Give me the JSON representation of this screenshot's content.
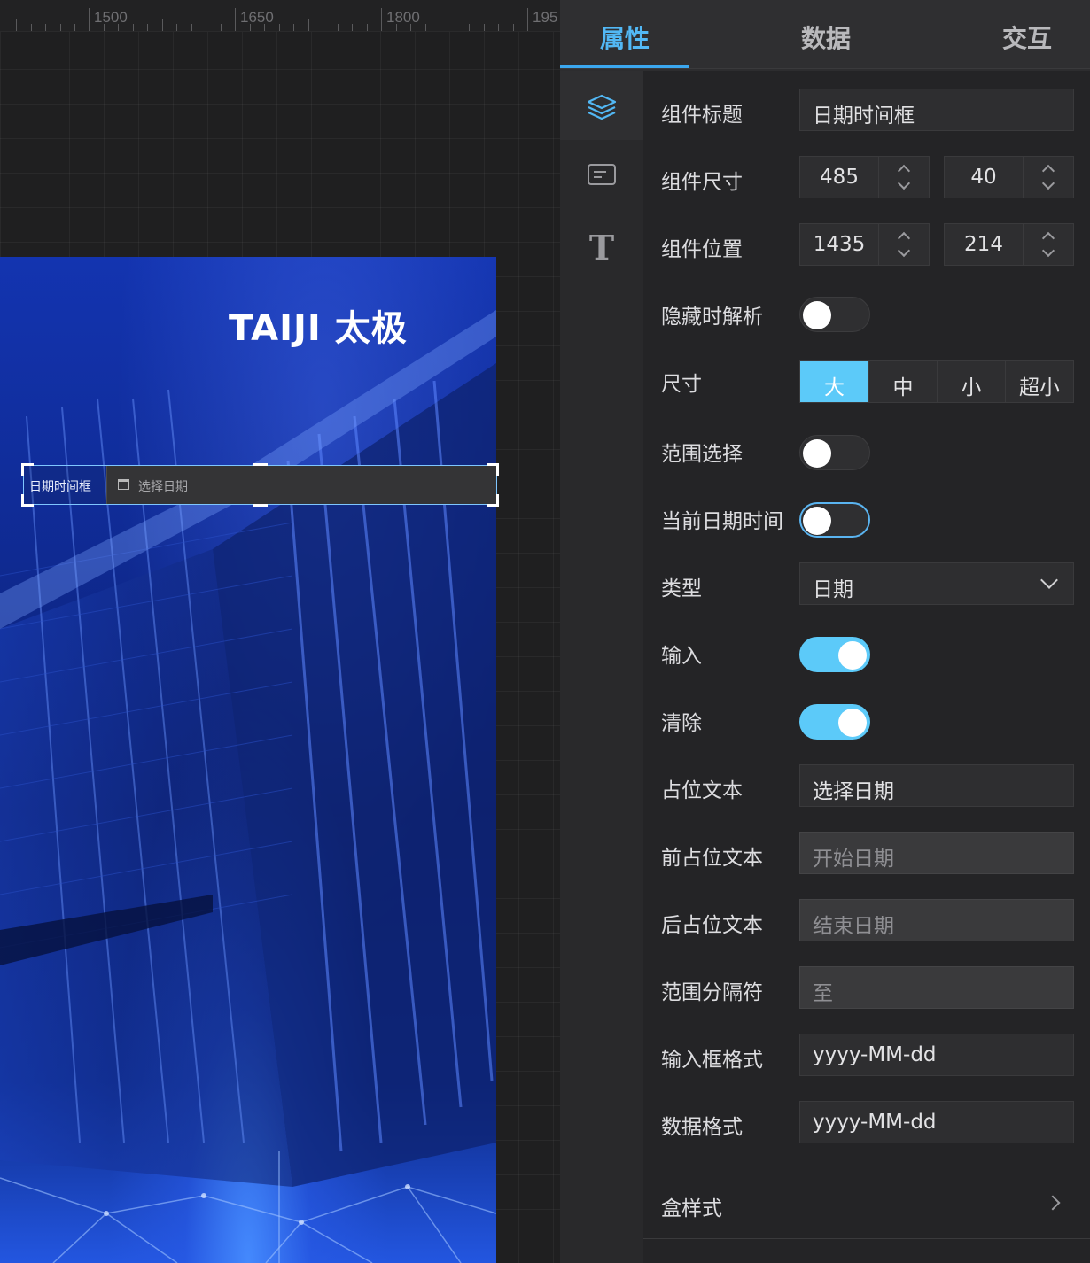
{
  "ruler": {
    "labels": [
      "1500",
      "1650",
      "1800",
      "195"
    ]
  },
  "canvas": {
    "logo_text": "TAIJI 太极",
    "widget": {
      "label": "日期时间框",
      "placeholder": "选择日期"
    }
  },
  "tabs": [
    {
      "label": "属性",
      "active": true
    },
    {
      "label": "数据",
      "active": false
    },
    {
      "label": "交互",
      "active": false
    }
  ],
  "side_icons": [
    "layers-icon",
    "card-icon",
    "text-icon"
  ],
  "accent_color": "#52b8f5",
  "form": {
    "title": {
      "label": "组件标题",
      "value": "日期时间框"
    },
    "size": {
      "label": "组件尺寸",
      "width": "485",
      "height": "40"
    },
    "position": {
      "label": "组件位置",
      "x": "1435",
      "y": "214"
    },
    "hide_parse": {
      "label": "隐藏时解析",
      "on": false
    },
    "dimension": {
      "label": "尺寸",
      "options": [
        "大",
        "中",
        "小",
        "超小"
      ],
      "selected": "大"
    },
    "range_select": {
      "label": "范围选择",
      "on": false
    },
    "current_datetime": {
      "label": "当前日期时间",
      "on": false
    },
    "type": {
      "label": "类型",
      "value": "日期"
    },
    "input": {
      "label": "输入",
      "on": true
    },
    "clear": {
      "label": "清除",
      "on": true
    },
    "placeholder": {
      "label": "占位文本",
      "value": "选择日期"
    },
    "start_placeholder": {
      "label": "前占位文本",
      "value": "开始日期"
    },
    "end_placeholder": {
      "label": "后占位文本",
      "value": "结束日期"
    },
    "range_separator": {
      "label": "范围分隔符",
      "value": "至"
    },
    "input_format": {
      "label": "输入框格式",
      "value": "yyyy-MM-dd"
    },
    "data_format": {
      "label": "数据格式",
      "value": "yyyy-MM-dd"
    },
    "box_style": {
      "label": "盒样式"
    }
  }
}
